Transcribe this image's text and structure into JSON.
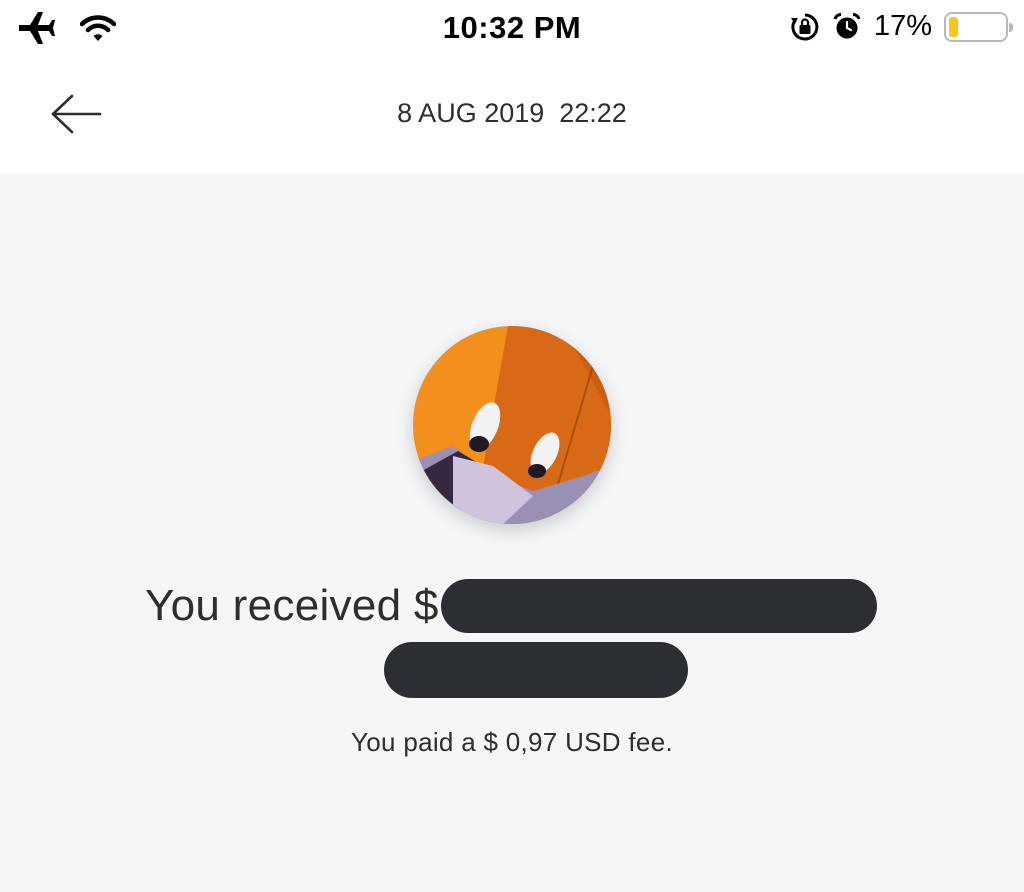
{
  "status_bar": {
    "time": "10:32 PM",
    "battery_percent": "17%",
    "battery_level": 0.17,
    "icons": [
      "airplane-icon",
      "wifi-icon",
      "rotation-lock-icon",
      "alarm-icon",
      "battery-icon"
    ]
  },
  "header": {
    "back_icon": "arrow-left-icon",
    "datetime": "8 AUG 2019  22:22"
  },
  "transaction": {
    "received_prefix": "You received $",
    "amount_redacted": true,
    "fee_text": "You paid a $ 0,97 USD fee."
  },
  "colors": {
    "background": "#f5f6f8",
    "header_bg": "#ffffff",
    "redaction": "#2b2f33",
    "battery_fill": "#f6c717",
    "text": "#2c2e2f"
  }
}
